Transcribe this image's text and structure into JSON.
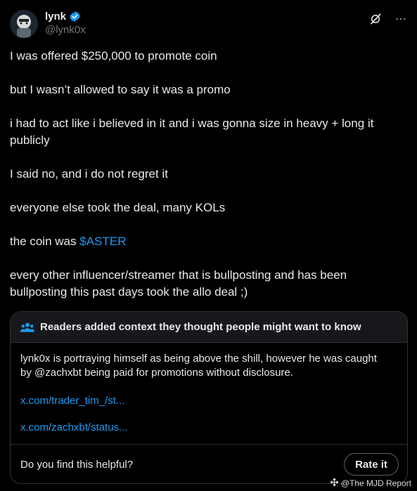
{
  "author": {
    "display_name": "lynk",
    "handle": "@lynk0x",
    "verified": true
  },
  "tweet": {
    "p1": "I was offered $250,000 to promote coin",
    "p2": "but I wasn’t allowed to say it was a promo",
    "p3": "i had to act like i believed in it and i was gonna size in heavy + long it publicly",
    "p4": "I said no, and i do not regret it",
    "p5": "everyone else took the deal, many KOLs",
    "p6_prefix": "the coin was ",
    "p6_cashtag": "$ASTER",
    "p7": "every other influencer/streamer that is bullposting and has been bullposting this past days took the allo deal ;)"
  },
  "community_note": {
    "header": "Readers added context they thought people might want to know",
    "text": "lynk0x is portraying himself as being above the shill, however he was caught by @zachxbt being paid for promotions without disclosure.",
    "link1": "x.com/trader_tim_/st...",
    "link2": "x.com/zachxbt/status...",
    "footer_question": "Do you find this helpful?",
    "rate_button": "Rate it"
  },
  "watermark": "@The MJD Report",
  "icons": [
    "verified-badge-icon",
    "grok-icon",
    "more-icon",
    "people-icon",
    "binance-logo-icon"
  ],
  "colors": {
    "accent": "#1d9bf0",
    "background": "#000000",
    "text": "#e7e9ea",
    "muted": "#71767b"
  }
}
